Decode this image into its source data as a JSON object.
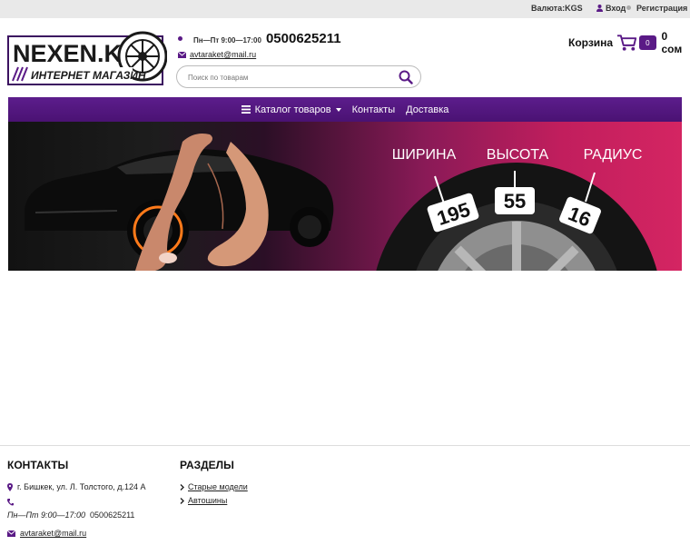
{
  "topbar": {
    "currency": "Валюта:KGS",
    "login": "Вход",
    "register": "Регистрация"
  },
  "logo": {
    "line1": "NEXEN.KG",
    "line2": "ИНТЕРНЕТ МАГАЗИН"
  },
  "header": {
    "hours": "Пн—Пт 9:00—17:00",
    "phone": "0500625211",
    "email": "avtaraket@mail.ru"
  },
  "search": {
    "placeholder": "Поиск по товарам"
  },
  "cart": {
    "label": "Корзина",
    "count": "0",
    "total": "0 сом"
  },
  "nav": {
    "catalog": "Каталог товаров",
    "contacts": "Контакты",
    "delivery": "Доставка"
  },
  "banner": {
    "width_label": "ШИРИНА",
    "height_label": "ВЫСОТА",
    "radius_label": "РАДИУС",
    "width_value": "195",
    "height_value": "55",
    "radius_value": "16"
  },
  "footer": {
    "contacts_title": "КОНТАКТЫ",
    "address": "г. Бишкек, ул. Л. Толстого, д.124 А",
    "hours": "Пн—Пт 9:00—17:00",
    "phone": "0500625211",
    "email": "avtaraket@mail.ru",
    "sections_title": "РАЗДЕЛЫ",
    "sections": [
      "Старые модели",
      "Автошины"
    ]
  },
  "colors": {
    "brand": "#5a1a86",
    "banner_accent": "#c11e5d"
  }
}
